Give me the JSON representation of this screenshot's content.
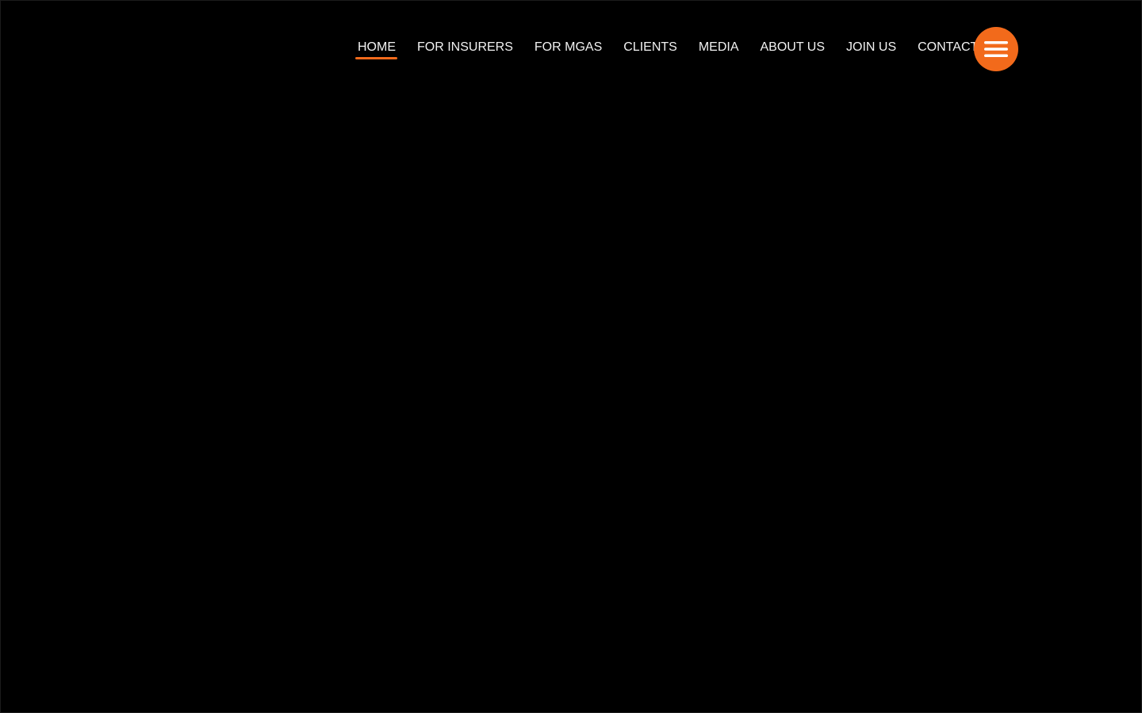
{
  "nav": {
    "items": [
      {
        "label": "HOME",
        "active": true
      },
      {
        "label": "FOR INSURERS",
        "active": false
      },
      {
        "label": "FOR MGAS",
        "active": false
      },
      {
        "label": "CLIENTS",
        "active": false
      },
      {
        "label": "MEDIA",
        "active": false
      },
      {
        "label": "ABOUT US",
        "active": false
      },
      {
        "label": "JOIN US",
        "active": false
      },
      {
        "label": "CONTACT",
        "active": false
      }
    ],
    "menu_button_icon": "hamburger-menu-icon"
  },
  "colors": {
    "background": "#000000",
    "accent": "#f26a1b",
    "nav_text": "#f2f2f2"
  }
}
